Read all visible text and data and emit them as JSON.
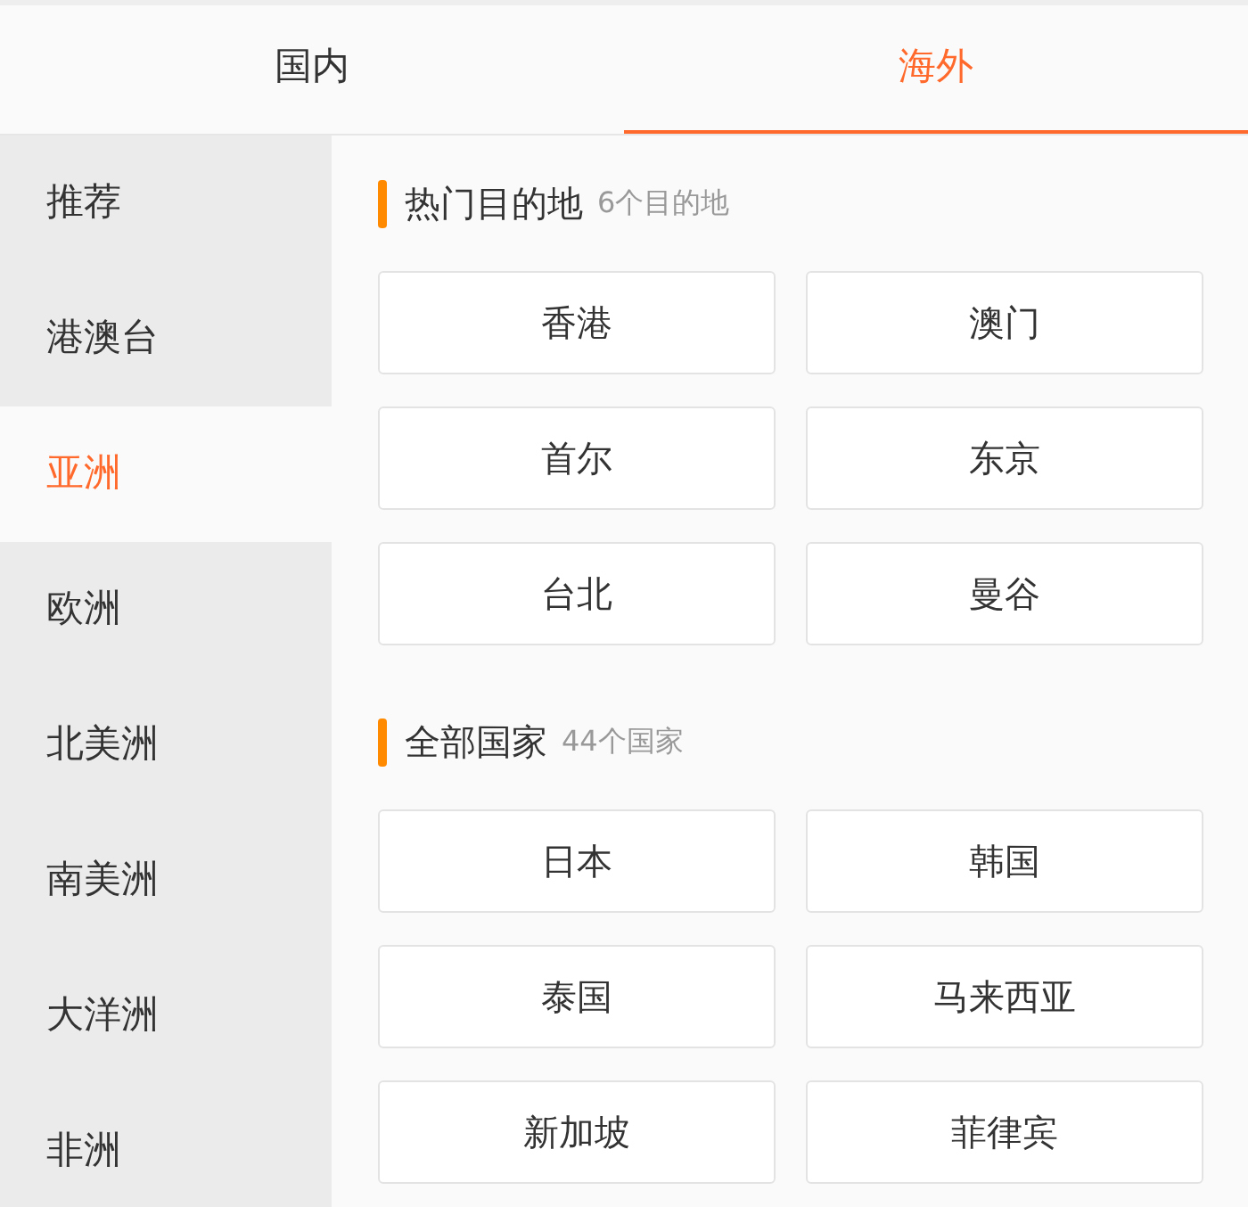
{
  "tabs": [
    {
      "label": "国内",
      "selected": false
    },
    {
      "label": "海外",
      "selected": true
    }
  ],
  "sidebar": {
    "items": [
      {
        "label": "推荐",
        "selected": false
      },
      {
        "label": "港澳台",
        "selected": false
      },
      {
        "label": "亚洲",
        "selected": true
      },
      {
        "label": "欧洲",
        "selected": false
      },
      {
        "label": "北美洲",
        "selected": false
      },
      {
        "label": "南美洲",
        "selected": false
      },
      {
        "label": "大洋洲",
        "selected": false
      },
      {
        "label": "非洲",
        "selected": false
      }
    ]
  },
  "sections": [
    {
      "title": "热门目的地",
      "count": "6个目的地",
      "items": [
        "香港",
        "澳门",
        "首尔",
        "东京",
        "台北",
        "曼谷"
      ]
    },
    {
      "title": "全部国家",
      "count": "44个国家",
      "items": [
        "日本",
        "韩国",
        "泰国",
        "马来西亚",
        "新加坡",
        "菲律宾"
      ]
    }
  ]
}
